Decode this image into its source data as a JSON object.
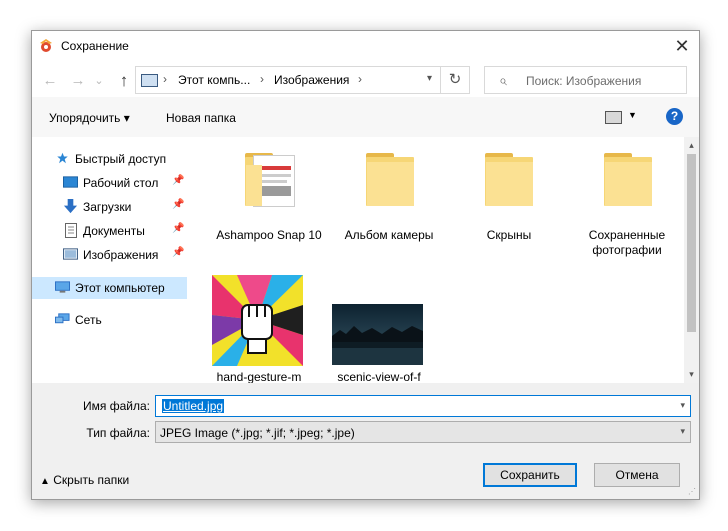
{
  "window": {
    "title": "Сохранение",
    "close_symbol": "✕"
  },
  "nav": {
    "back_symbol": "←",
    "forward_symbol": "→",
    "recent_symbol": "⌄",
    "up_symbol": "↑",
    "breadcrumbs": [
      "Этот компь...",
      "Изображения"
    ],
    "crumb_sep": "›",
    "refresh_symbol": "↻",
    "search_placeholder": "Поиск: Изображения"
  },
  "toolbar": {
    "organize": "Упорядочить ▾",
    "new_folder": "Новая папка",
    "help": "?"
  },
  "sidebar": {
    "items": [
      {
        "label": "Быстрый доступ",
        "icon": "star-icon"
      },
      {
        "label": "Рабочий стол",
        "icon": "desktop-icon",
        "pinned": true
      },
      {
        "label": "Загрузки",
        "icon": "download-icon",
        "pinned": true
      },
      {
        "label": "Документы",
        "icon": "documents-icon",
        "pinned": true
      },
      {
        "label": "Изображения",
        "icon": "pictures-icon",
        "pinned": true
      },
      {
        "label": "Этот компьютер",
        "icon": "computer-icon",
        "selected": true
      },
      {
        "label": "Сеть",
        "icon": "network-icon"
      }
    ],
    "pin_symbol": "📌"
  },
  "files": [
    {
      "label": "Ashampoo Snap 10",
      "kind": "folder-with-preview"
    },
    {
      "label": "Альбом камеры",
      "kind": "folder"
    },
    {
      "label": "Скрыны",
      "kind": "folder"
    },
    {
      "label": "Сохраненные фотографии",
      "kind": "folder"
    },
    {
      "label": "hand-gesture-m",
      "kind": "image"
    },
    {
      "label": "scenic-view-of-f",
      "kind": "image"
    }
  ],
  "form": {
    "filename_label": "Имя файла:",
    "filename_value": "Untitled.jpg",
    "filetype_label": "Тип файла:",
    "filetype_value": "JPEG Image (*.jpg; *.jif; *.jpeg; *.jpe)"
  },
  "footer": {
    "hide_folders": "Скрыть папки",
    "save": "Сохранить",
    "cancel": "Отмена"
  },
  "colors": {
    "accent": "#0078d7",
    "selected_bg": "#cce8ff",
    "folder": "#f6d676"
  }
}
